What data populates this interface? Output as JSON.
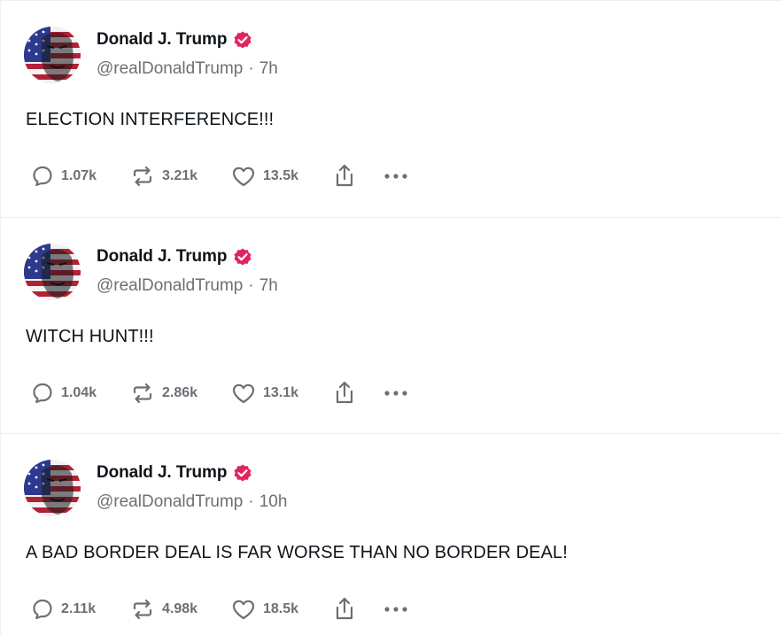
{
  "colors": {
    "verified_badge": "#e0245e",
    "muted_text": "#6b7075",
    "primary_text": "#0f1419"
  },
  "posts": [
    {
      "author": "Donald J. Trump",
      "handle": "@realDonaldTrump",
      "separator": "·",
      "time": "7h",
      "text": "ELECTION INTERFERENCE!!!",
      "replies": "1.07k",
      "reposts": "3.21k",
      "likes": "13.5k"
    },
    {
      "author": "Donald J. Trump",
      "handle": "@realDonaldTrump",
      "separator": "·",
      "time": "7h",
      "text": "WITCH HUNT!!!",
      "replies": "1.04k",
      "reposts": "2.86k",
      "likes": "13.1k"
    },
    {
      "author": "Donald J. Trump",
      "handle": "@realDonaldTrump",
      "separator": "·",
      "time": "10h",
      "text": "A BAD BORDER DEAL IS FAR WORSE THAN NO BORDER DEAL!",
      "replies": "2.11k",
      "reposts": "4.98k",
      "likes": "18.5k"
    }
  ],
  "icons": {
    "reply": "reply-icon",
    "repost": "repost-icon",
    "like": "heart-icon",
    "share": "share-icon",
    "more": "more-icon",
    "verified": "verified-badge-icon"
  }
}
